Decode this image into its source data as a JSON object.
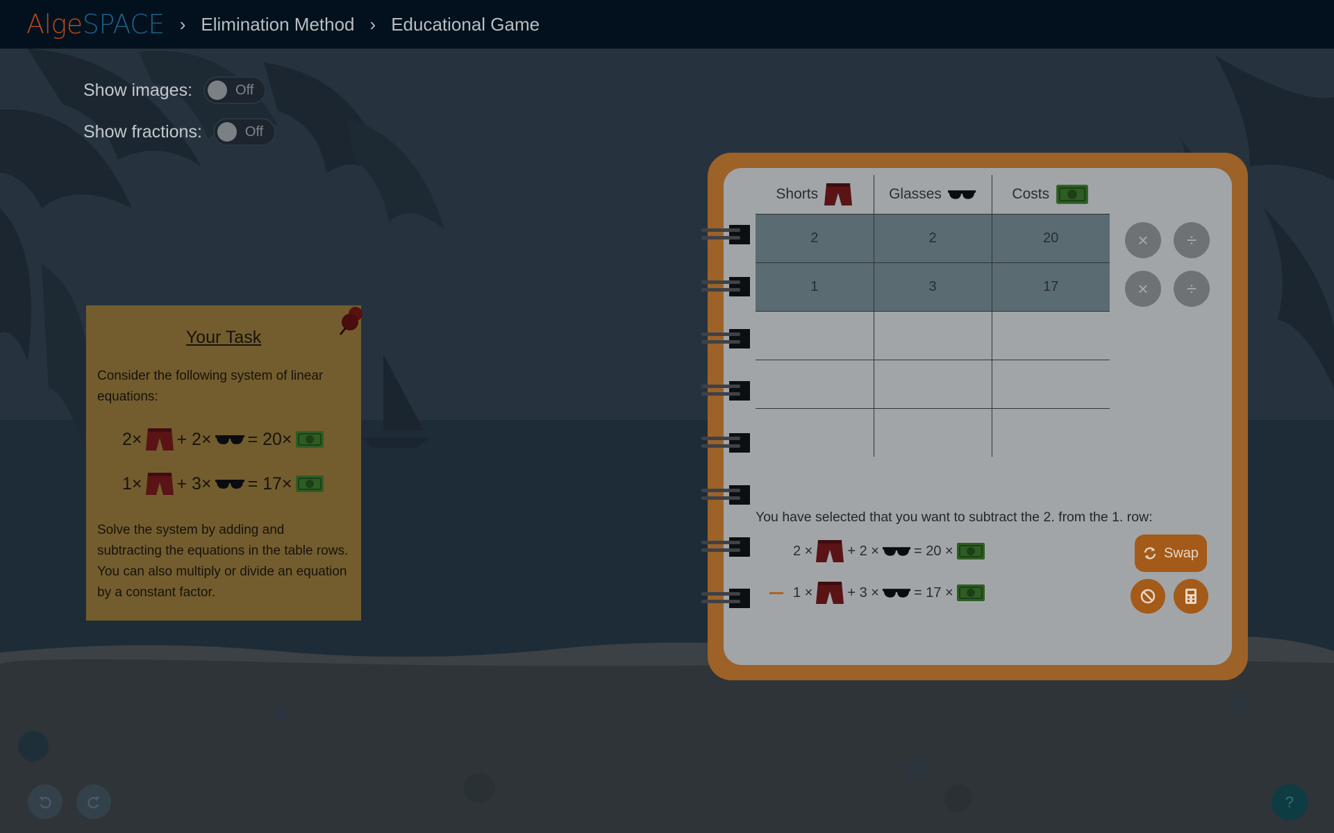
{
  "header": {
    "logo_part1": "Alge",
    "logo_part2": "SPACE",
    "breadcrumb": [
      "Elimination Method",
      "Educational Game"
    ]
  },
  "toggles": {
    "images_label": "Show images:",
    "images_state": "Off",
    "fractions_label": "Show fractions:",
    "fractions_state": "Off"
  },
  "task": {
    "title": "Your Task",
    "intro": "Consider the following system of linear equations:",
    "eq1": {
      "a": "2×",
      "plus": "+ 2×",
      "eq": "= 20×"
    },
    "eq2": {
      "a": "1×",
      "plus": "+ 3×",
      "eq": "= 17×"
    },
    "body": "Solve the system by adding and subtracting the equations in the table rows. You can also multiply or divide an equation by a constant factor."
  },
  "table": {
    "headers": [
      "Shorts",
      "Glasses",
      "Costs"
    ],
    "rows": [
      [
        "2",
        "2",
        "20"
      ],
      [
        "1",
        "3",
        "17"
      ],
      [
        "",
        "",
        ""
      ],
      [
        "",
        "",
        ""
      ],
      [
        "",
        "",
        ""
      ]
    ],
    "multiply_symbol": "×",
    "divide_symbol": "÷"
  },
  "selection": {
    "message": "You have selected that you want to subtract the 2. from the 1. row:",
    "line1": {
      "a": "2 ×",
      "b": "+ 2 ×",
      "c": "= 20 ×"
    },
    "line2": {
      "a": "1 ×",
      "b": "+ 3 ×",
      "c": "= 17 ×"
    },
    "swap_label": "Swap"
  },
  "footer": {
    "help": "?"
  },
  "colors": {
    "accent_orange": "#a45a18",
    "selected_row": "#5a6b72",
    "header_bg": "#02111d"
  },
  "icons": [
    "shorts-icon",
    "glasses-icon",
    "money-icon",
    "pushpin-icon",
    "swap-icon",
    "cancel-icon",
    "calculator-icon",
    "undo-icon",
    "redo-icon"
  ]
}
